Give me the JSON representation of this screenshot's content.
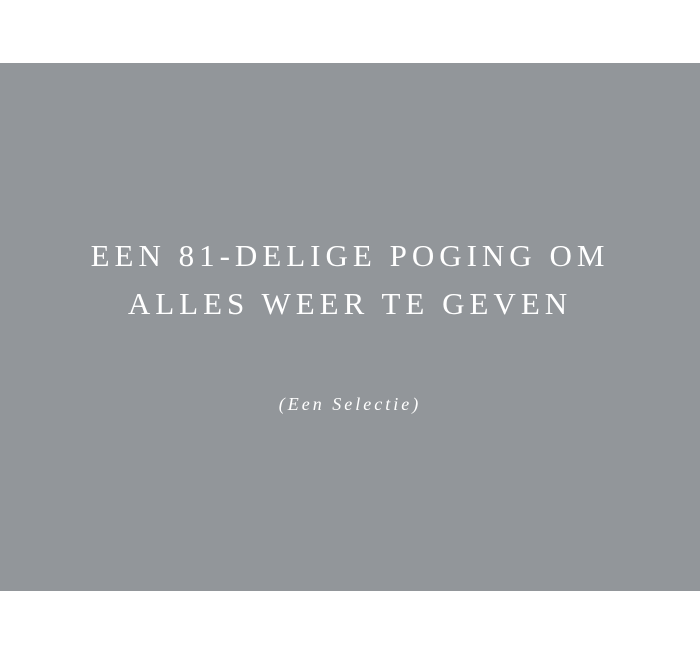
{
  "cover": {
    "title_lines": [
      "EEN 81-DELIGE POGING OM",
      "ALLES WEER TE GEVEN"
    ],
    "subtitle": "(Een Selectie)"
  },
  "colors": {
    "page_background": "#ffffff",
    "panel_background": "#92969a",
    "text": "#ffffff"
  }
}
